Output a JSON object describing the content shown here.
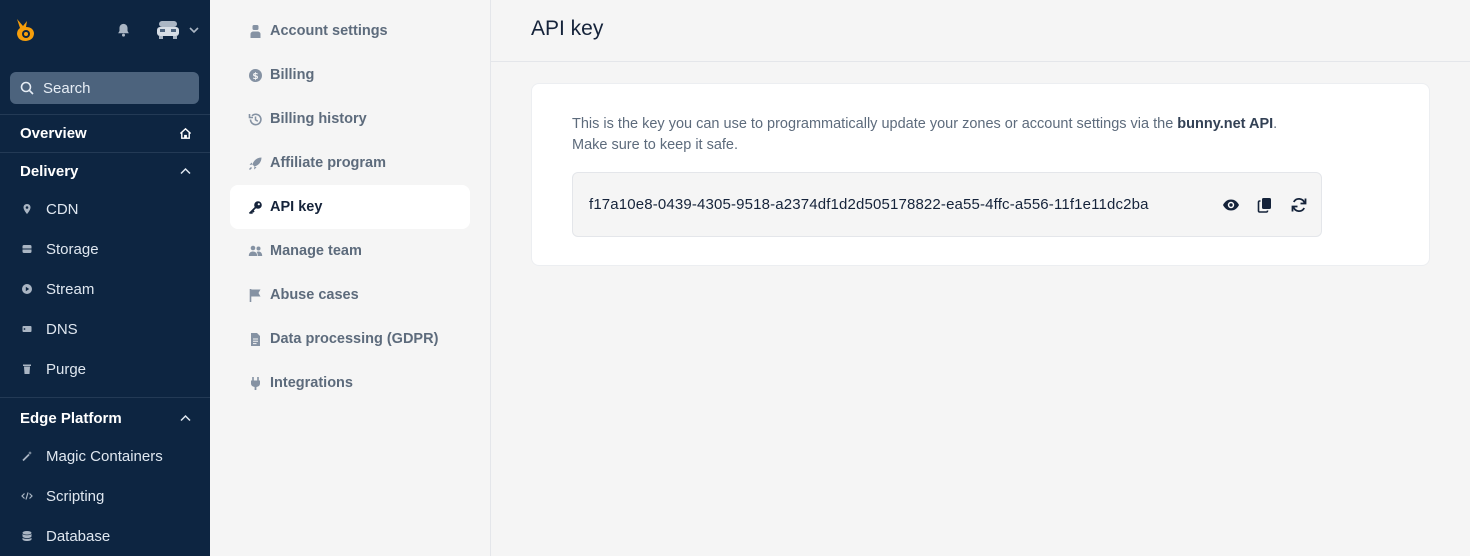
{
  "sidebar": {
    "search_placeholder": "Search",
    "overview_label": "Overview",
    "delivery": {
      "label": "Delivery",
      "items": [
        {
          "label": "CDN",
          "icon": "pin-icon"
        },
        {
          "label": "Storage",
          "icon": "storage-icon"
        },
        {
          "label": "Stream",
          "icon": "play-icon"
        },
        {
          "label": "DNS",
          "icon": "dns-icon"
        },
        {
          "label": "Purge",
          "icon": "trash-icon"
        }
      ]
    },
    "edge": {
      "label": "Edge Platform",
      "items": [
        {
          "label": "Magic Containers",
          "icon": "magic-wand-icon"
        },
        {
          "label": "Scripting",
          "icon": "code-icon"
        },
        {
          "label": "Database",
          "icon": "database-icon"
        }
      ]
    }
  },
  "subnav": {
    "items": [
      {
        "label": "Account settings",
        "icon": "user-icon"
      },
      {
        "label": "Billing",
        "icon": "dollar-icon"
      },
      {
        "label": "Billing history",
        "icon": "history-icon"
      },
      {
        "label": "Affiliate program",
        "icon": "rocket-icon"
      },
      {
        "label": "API key",
        "icon": "key-icon",
        "active": true
      },
      {
        "label": "Manage team",
        "icon": "team-icon"
      },
      {
        "label": "Abuse cases",
        "icon": "flag-icon"
      },
      {
        "label": "Data processing (GDPR)",
        "icon": "document-icon"
      },
      {
        "label": "Integrations",
        "icon": "plug-icon"
      }
    ]
  },
  "main": {
    "title": "API key",
    "description_prefix": "This is the key you can use to programmatically update your zones or account settings via the ",
    "description_bold": "bunny.net API",
    "description_suffix": ".",
    "description_line2": "Make sure to keep it safe.",
    "api_key": "f17a10e8-0439-4305-9518-a2374df1d2d505178822-ea55-4ffc-a556-11f1e11dc2ba"
  },
  "colors": {
    "sidebar_bg": "#0d2541",
    "accent": "#f59e0b",
    "main_bg": "#f5f5f5"
  }
}
